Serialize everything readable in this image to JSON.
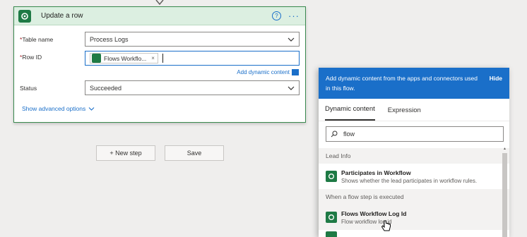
{
  "card": {
    "title": "Update a row",
    "help_symbol": "?",
    "more_symbol": "···",
    "table_name": {
      "label": "Table name",
      "required_mark": "*",
      "value": "Process Logs"
    },
    "row_id": {
      "label": "Row ID",
      "required_mark": "*",
      "token": "Flows Workflo...",
      "token_remove": "×"
    },
    "add_dynamic_content": "Add dynamic content",
    "status": {
      "label": "Status",
      "value": "Succeeded"
    },
    "show_advanced": "Show advanced options"
  },
  "buttons": {
    "new_step": "+ New step",
    "save": "Save"
  },
  "flyout": {
    "header_text": "Add dynamic content from the apps and connectors used in this flow.",
    "hide_label": "Hide",
    "tabs": [
      "Dynamic content",
      "Expression"
    ],
    "active_tab": "Dynamic content",
    "search_value": "flow",
    "sections": [
      {
        "title": "Lead Info",
        "items": [
          {
            "title": "Participates in Workflow",
            "description": "Shows whether the lead participates in workflow rules."
          }
        ]
      },
      {
        "title": "When a flow step is executed",
        "items": [
          {
            "title": "Flows Workflow Log Id",
            "description": "Flow workflow log id"
          }
        ]
      }
    ]
  },
  "colors": {
    "accent": "#1a6fc9",
    "dataverse_green": "#1e7a45",
    "card_border": "#3a8a4f"
  }
}
